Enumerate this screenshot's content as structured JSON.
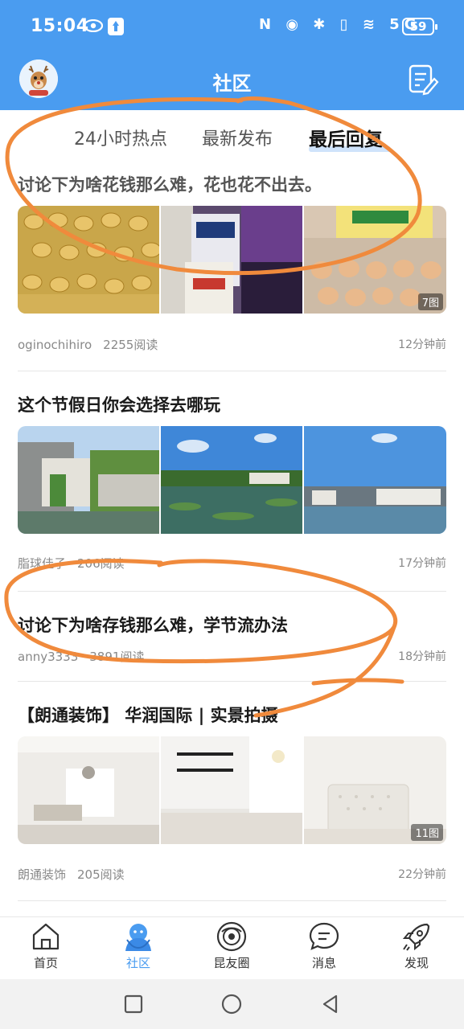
{
  "status": {
    "time": "15:04",
    "icons": "N ◉ ✱ ▯ ≋ 5G",
    "battery": "59"
  },
  "header": {
    "title": "社区"
  },
  "tabs": [
    {
      "label": "24小时热点"
    },
    {
      "label": "最新发布"
    },
    {
      "label": "最后回复"
    }
  ],
  "posts": [
    {
      "title": "讨论下为啥花钱那么难，花也花不出去。",
      "author": "oginochihiro",
      "reads": "2255阅读",
      "time": "12分钟前",
      "image_count": "7图"
    },
    {
      "title": "这个节假日你会选择去哪玩",
      "author": "脂球佳子",
      "reads": "206阅读",
      "time": "17分钟前"
    },
    {
      "title": "讨论下为啥存钱那么难，学节流办法",
      "author": "anny3333",
      "reads": "3891阅读",
      "time": "18分钟前"
    },
    {
      "title": "【朗通装饰】 华润国际 | 实景拍摄",
      "author": "朗通装饰",
      "reads": "205阅读",
      "time": "22分钟前",
      "image_count": "11图"
    }
  ],
  "bottom_nav": [
    {
      "label": "首页",
      "icon": "home-icon"
    },
    {
      "label": "社区",
      "icon": "community-icon"
    },
    {
      "label": "昆友圈",
      "icon": "circle-icon"
    },
    {
      "label": "消息",
      "icon": "message-icon"
    },
    {
      "label": "发现",
      "icon": "rocket-icon"
    }
  ],
  "colors": {
    "brand": "#4a9cf0",
    "annotation": "#f08a3c"
  }
}
